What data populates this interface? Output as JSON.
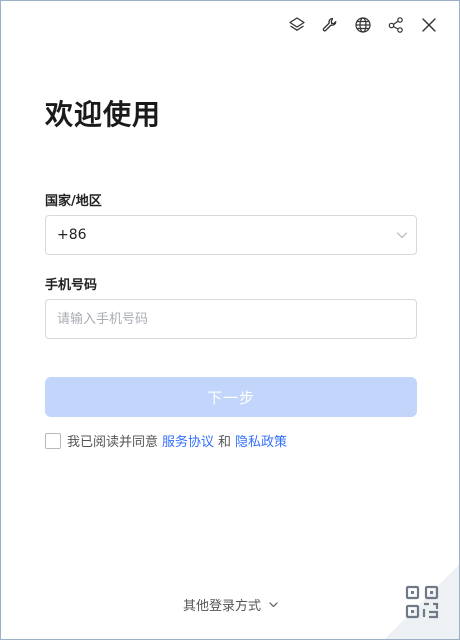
{
  "toolbar": {
    "icons": [
      "layers-icon",
      "wrench-icon",
      "globe-icon",
      "share-icon",
      "close-icon"
    ]
  },
  "login": {
    "title": "欢迎使用",
    "country_label": "国家/地区",
    "country_code": "+86",
    "phone_label": "手机号码",
    "phone_placeholder": "请输入手机号码",
    "phone_value": "",
    "next_button": "下一步",
    "agree_text": "我已阅读并同意",
    "service_link": "服务协议",
    "and_text": "和",
    "privacy_link": "隐私政策",
    "agreed": false
  },
  "footer": {
    "other_login": "其他登录方式"
  },
  "colors": {
    "accent": "#3370ff",
    "button_disabled_bg": "#c2d6fc",
    "border": "#d6d9de",
    "window_border": "#9bb0c6"
  }
}
